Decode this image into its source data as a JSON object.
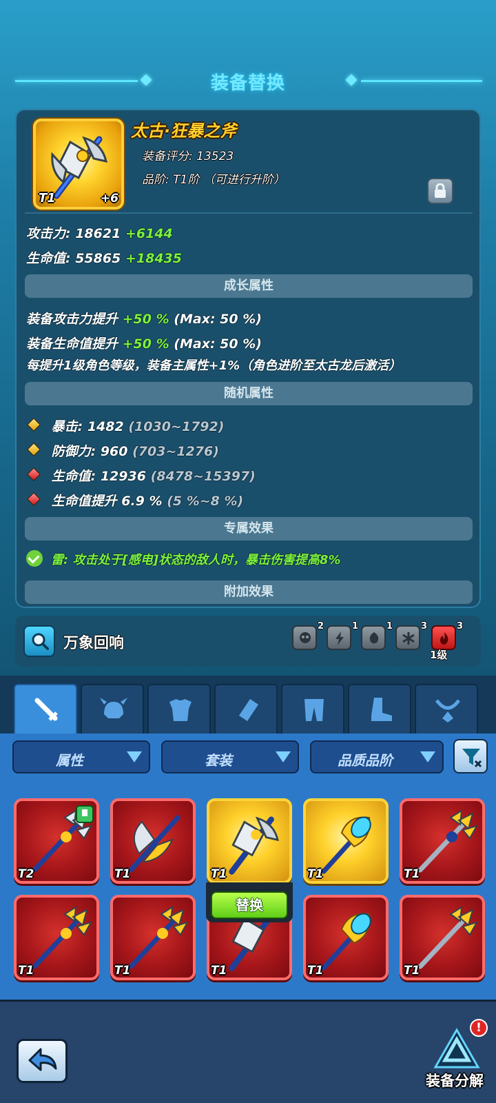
{
  "header": {
    "title": "装备替换"
  },
  "item": {
    "name": "太古·狂暴之斧",
    "score": "装备评分: 13523",
    "grade": "品阶: T1阶 （可进行升阶）",
    "tier": "T1",
    "plus": "+6"
  },
  "stats": {
    "attack_label": "攻击力: 18621",
    "attack_bonus": "+6144",
    "hp_label": "生命值: 55865",
    "hp_bonus": "+18435"
  },
  "growth": {
    "header": "成长属性",
    "line1_a": "装备攻击力提升",
    "line1_b": "+50 %",
    "line1_c": "(Max: 50 %)",
    "line2_a": "装备生命值提升",
    "line2_b": "+50 %",
    "line2_c": "(Max: 50 %)",
    "line3": "每提升1级角色等级，装备主属性+1%（角色进阶至太古龙后激活）"
  },
  "random": {
    "header": "随机属性",
    "items": [
      {
        "label": "暴击: 1482",
        "range": "(1030~1792)",
        "gem": "gold"
      },
      {
        "label": "防御力: 960",
        "range": "(703~1276)",
        "gem": "gold"
      },
      {
        "label": "生命值: 12936",
        "range": "(8478~15397)",
        "gem": "red"
      },
      {
        "label": "生命值提升 6.9 %",
        "range": "(5 %~8 %)",
        "gem": "red"
      }
    ]
  },
  "exclusive": {
    "header": "专属效果",
    "effect": "雷: 攻击处于[感电]状态的敌人时，暴击伤害提高8%"
  },
  "extra": {
    "header": "附加效果"
  },
  "echo": {
    "label": "万象回响",
    "elements": [
      {
        "icon": "skull-icon",
        "count": "2"
      },
      {
        "icon": "lightning-icon",
        "count": "1"
      },
      {
        "icon": "poison-icon",
        "count": "1"
      },
      {
        "icon": "frost-icon",
        "count": "3"
      },
      {
        "icon": "fire-icon",
        "count": "3",
        "level": "1级"
      }
    ]
  },
  "tabs": [
    "weapon",
    "helmet",
    "armor",
    "bracer",
    "pants",
    "boots",
    "necklace"
  ],
  "filters": {
    "attribute": "属性",
    "set": "套装",
    "quality": "品质品阶"
  },
  "inventory": {
    "slots": [
      {
        "tier": "T2",
        "frame": "red",
        "icon": "trident-icon",
        "badge": true
      },
      {
        "tier": "T1",
        "frame": "red",
        "icon": "double-axe-icon"
      },
      {
        "tier": "T1",
        "frame": "gold",
        "icon": "axe-icon",
        "selected": true
      },
      {
        "tier": "T1",
        "frame": "gold",
        "icon": "gem-staff-icon"
      },
      {
        "tier": "T1",
        "frame": "red",
        "icon": "trident-icon"
      },
      {
        "tier": "T1",
        "frame": "red",
        "icon": "trident-icon"
      },
      {
        "tier": "T1",
        "frame": "red",
        "icon": "trident-icon"
      },
      {
        "tier": "T1",
        "frame": "red",
        "icon": "axe-icon"
      },
      {
        "tier": "T1",
        "frame": "red",
        "icon": "gem-staff-icon"
      },
      {
        "tier": "T1",
        "frame": "red",
        "icon": "trident-icon"
      }
    ],
    "replace_label": "替换"
  },
  "footer": {
    "decompose_label": "装备分解",
    "notification": "!"
  }
}
